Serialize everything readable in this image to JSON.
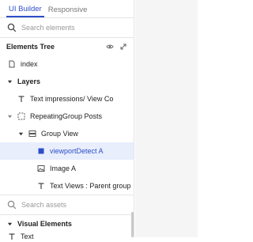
{
  "tabs": {
    "ui_builder": "UI Builder",
    "responsive": "Responsive"
  },
  "search_elements": {
    "placeholder": "Search elements"
  },
  "elements_tree": {
    "title": "Elements Tree"
  },
  "tree": {
    "index": "index",
    "layers": "Layers",
    "text_impressions": "Text impressions/ View Co",
    "repeating_group": "RepeatingGroup Posts",
    "group_view": "Group View",
    "viewport_detect": "viewportDetect A",
    "image_a": "Image A",
    "text_views": "Text Views : Parent group"
  },
  "search_assets": {
    "placeholder": "Search assets"
  },
  "visual_elements": {
    "title": "Visual Elements",
    "first_item": "Text"
  },
  "colors": {
    "accent": "#2d4ec7",
    "selected_bg": "#e8eefc"
  }
}
